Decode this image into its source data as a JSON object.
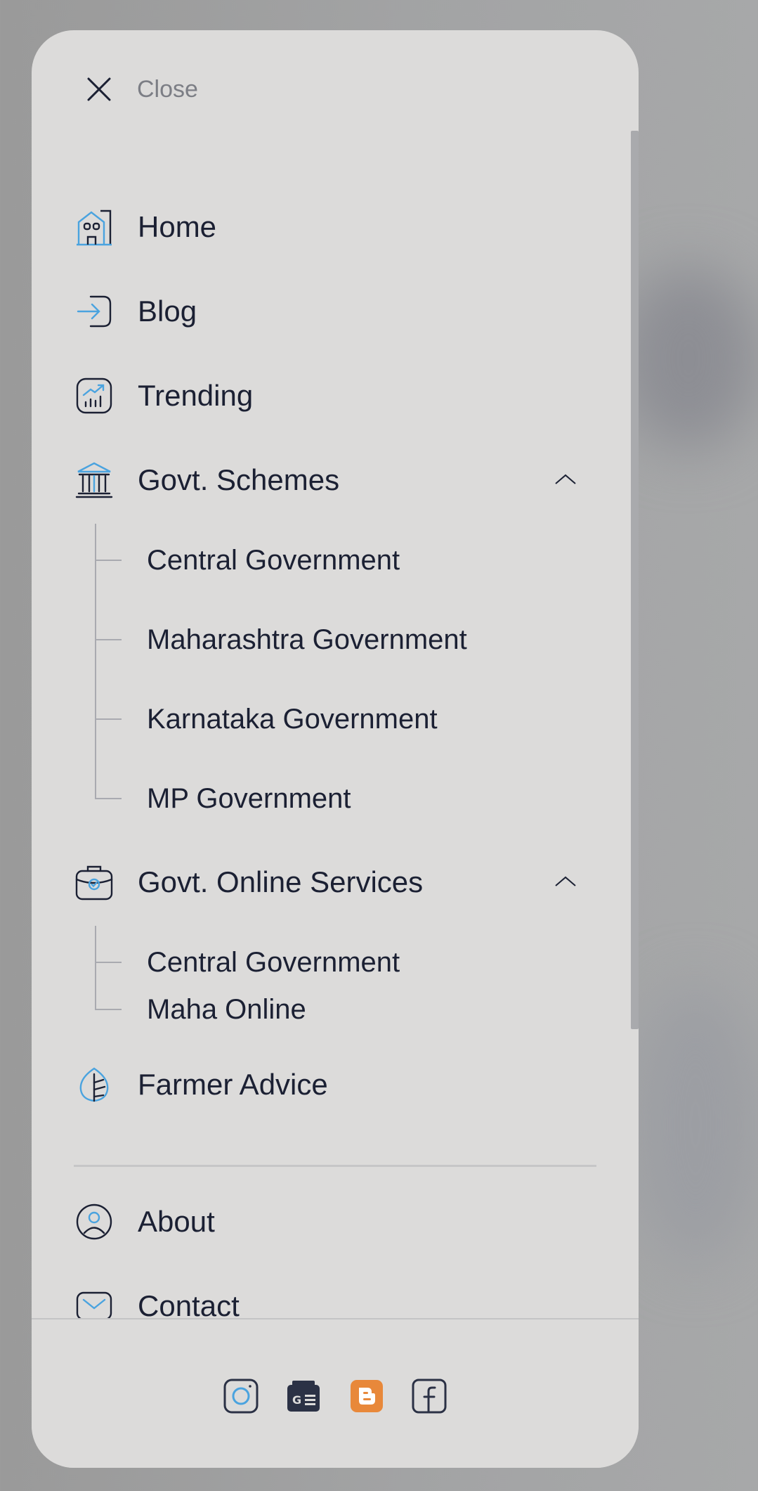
{
  "drawer": {
    "close_label": "Close",
    "menu": [
      {
        "label": "Home",
        "icon": "home-icon"
      },
      {
        "label": "Blog",
        "icon": "login-arrow-icon"
      },
      {
        "label": "Trending",
        "icon": "trending-chart-icon"
      },
      {
        "label": "Govt. Schemes",
        "icon": "bank-building-icon",
        "expanded": true,
        "children": [
          "Central Government",
          "Maharashtra Government",
          "Karnataka Government",
          "MP Government"
        ]
      },
      {
        "label": "Govt. Online Services",
        "icon": "briefcase-check-icon",
        "expanded": true,
        "children": [
          "Central Government",
          "Maha Online"
        ]
      },
      {
        "label": "Farmer Advice",
        "icon": "leaf-icon"
      },
      {
        "label": "About",
        "icon": "user-circle-icon"
      },
      {
        "label": "Contact",
        "icon": "mail-icon"
      }
    ],
    "footer_social": [
      "instagram-icon",
      "google-news-icon",
      "blogger-icon",
      "facebook-icon"
    ]
  },
  "colors": {
    "panel": "#dcdbda",
    "text": "#1b2033",
    "accent_blue": "#4aa3df",
    "blogger_orange": "#e8883a"
  }
}
